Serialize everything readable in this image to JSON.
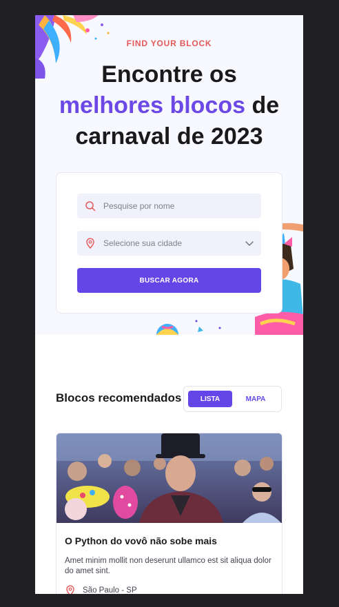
{
  "hero": {
    "eyebrow": "FIND YOUR BLOCK",
    "title_line1": "Encontre os",
    "title_accent": "melhores blocos",
    "title_after_accent": " de",
    "title_line3": "carnaval de 2023"
  },
  "search": {
    "name_placeholder": "Pesquise por nome",
    "city_placeholder": "Selecione sua cidade",
    "submit_label": "BUSCAR AGORA"
  },
  "recommended": {
    "title": "Blocos recomendados",
    "view_tabs": [
      {
        "label": "LISTA",
        "active": true
      },
      {
        "label": "MAPA",
        "active": false
      }
    ]
  },
  "cards": [
    {
      "title": "O Python do vovô não sobe mais",
      "description": "Amet minim mollit non deserunt ullamco est sit aliqua dolor do amet sint.",
      "location": "São Paulo - SP"
    }
  ],
  "colors": {
    "accent": "#6446e8",
    "eyebrow": "#e45858",
    "hero_bg": "#f8f8ff"
  },
  "icons": {
    "search": "search-icon",
    "location": "map-pin-icon",
    "dropdown": "chevron-down-icon"
  }
}
